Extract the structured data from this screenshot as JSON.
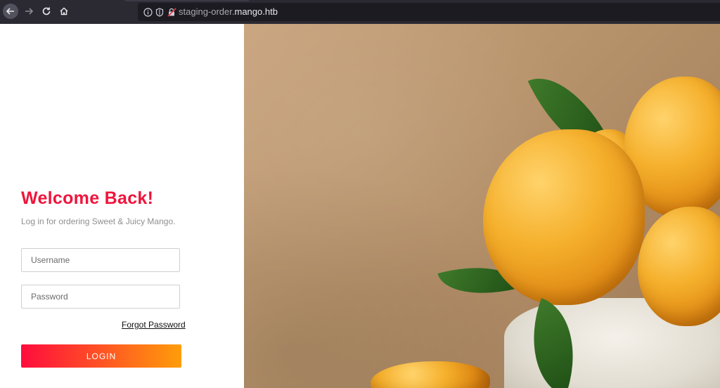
{
  "browser": {
    "url_prefix": "staging-order.",
    "url_domain": "mango.htb",
    "icons": [
      "arrow-left-icon",
      "arrow-right-icon",
      "reload-icon",
      "home-icon",
      "info-icon",
      "shield-icon",
      "lock-warning-icon"
    ]
  },
  "login": {
    "title": "Welcome Back!",
    "subtitle": "Log in for ordering Sweet & Juicy Mango.",
    "username_placeholder": "Username",
    "password_placeholder": "Password",
    "forgot_label": "Forgot Password",
    "login_label": "LOGIN"
  },
  "hero": {
    "description_colors": {
      "background": "#b8946c",
      "mango": "#f5b02c",
      "leaf": "#3f7a2a",
      "accent": "#f0143c"
    }
  }
}
